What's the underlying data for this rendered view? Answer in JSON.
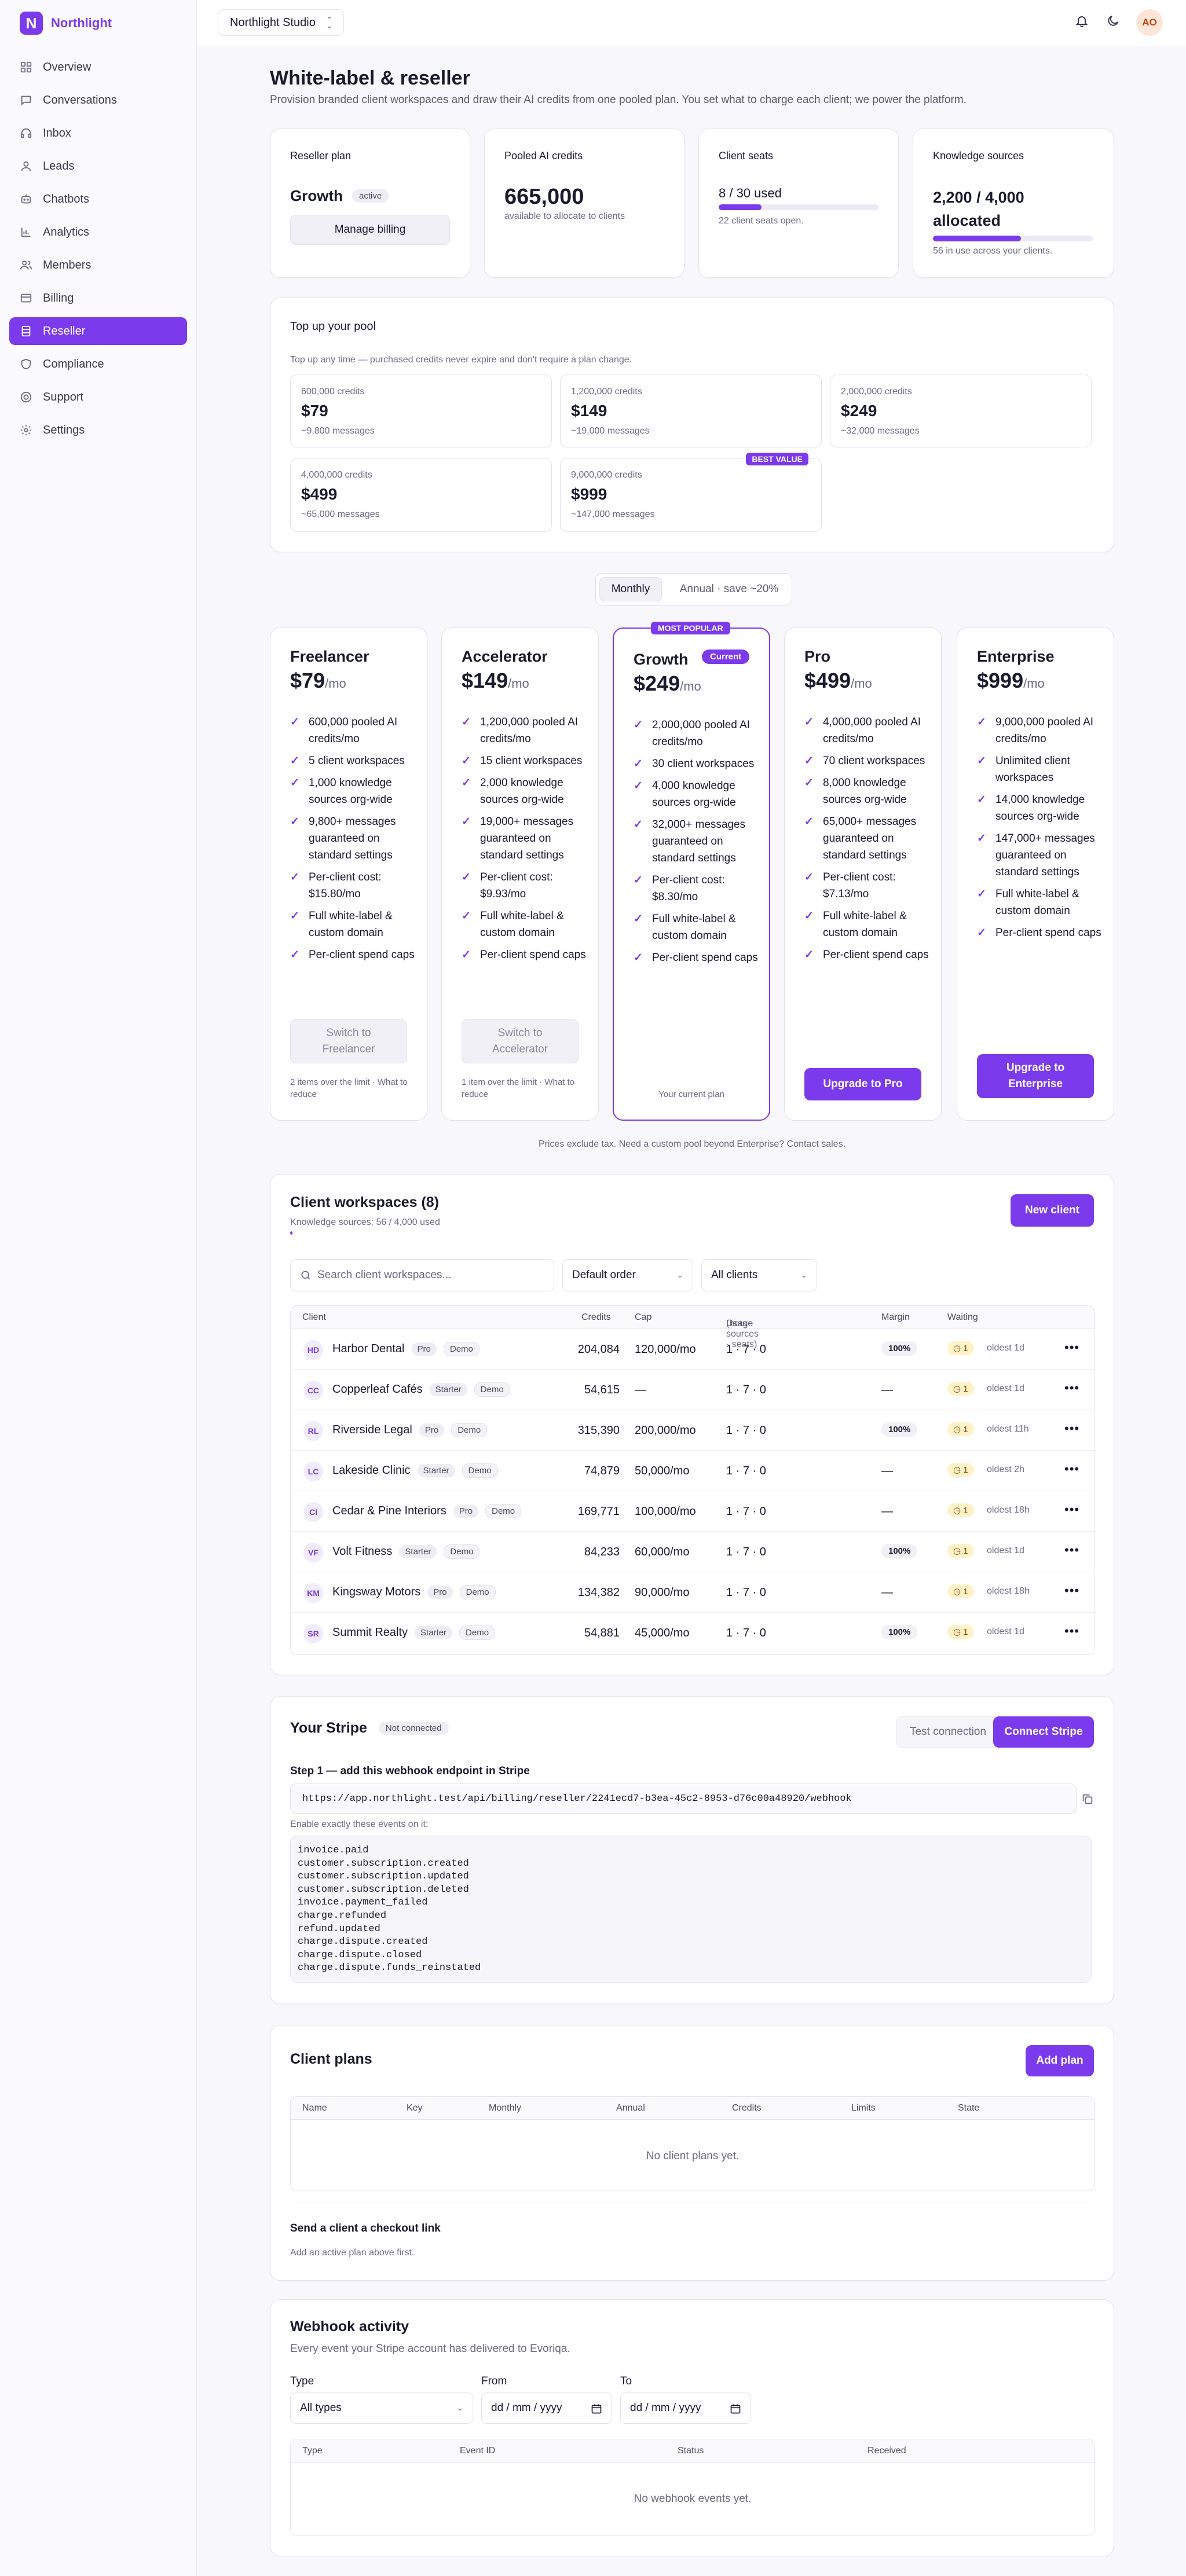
{
  "brand": {
    "name": "Northlight",
    "logo_letter": "N"
  },
  "sidebar": {
    "items": [
      {
        "label": "Overview",
        "icon": "grid-icon"
      },
      {
        "label": "Conversations",
        "icon": "chat-icon"
      },
      {
        "label": "Inbox",
        "icon": "headset-icon"
      },
      {
        "label": "Leads",
        "icon": "user-icon"
      },
      {
        "label": "Chatbots",
        "icon": "bot-icon"
      },
      {
        "label": "Analytics",
        "icon": "chart-icon"
      },
      {
        "label": "Members",
        "icon": "users-icon"
      },
      {
        "label": "Billing",
        "icon": "card-icon"
      },
      {
        "label": "Reseller",
        "icon": "stack-icon"
      },
      {
        "label": "Compliance",
        "icon": "shield-icon"
      },
      {
        "label": "Support",
        "icon": "lifebuoy-icon"
      },
      {
        "label": "Settings",
        "icon": "gear-icon"
      }
    ],
    "active_index": 8
  },
  "topbar": {
    "workspace": "Northlight Studio",
    "avatar": "AO"
  },
  "page": {
    "title": "White-label & reseller",
    "subtitle": "Provision branded client workspaces and draw their AI credits from one pooled plan. You set what to charge each client; we power the platform."
  },
  "stats": {
    "plan": {
      "label": "Reseller plan",
      "value": "Growth",
      "badge": "active",
      "button": "Manage billing"
    },
    "credits": {
      "label": "Pooled AI credits",
      "value": "665,000",
      "note": "available to allocate to clients"
    },
    "seats": {
      "label": "Client seats",
      "value": "8 / 30 used",
      "note": "22 client seats open.",
      "progress": 0.267
    },
    "knowledge": {
      "label": "Knowledge sources",
      "value": "2,200 / 4,000 allocated",
      "note": "56 in use across your clients.",
      "progress": 0.55
    }
  },
  "topup": {
    "title": "Top up your pool",
    "note": "Top up any time — purchased credits never expire and don't require a plan change.",
    "packs": [
      {
        "credits": "600,000 credits",
        "price": "$79",
        "messages": "~9,800 messages"
      },
      {
        "credits": "1,200,000 credits",
        "price": "$149",
        "messages": "~19,000 messages"
      },
      {
        "credits": "2,000,000 credits",
        "price": "$249",
        "messages": "~32,000 messages"
      },
      {
        "credits": "4,000,000 credits",
        "price": "$499",
        "messages": "~65,000 messages"
      },
      {
        "credits": "9,000,000 credits",
        "price": "$999",
        "messages": "~147,000 messages",
        "badge": "BEST VALUE"
      }
    ]
  },
  "billing_toggle": {
    "monthly": "Monthly",
    "annual": "Annual · save ~20%"
  },
  "plans": [
    {
      "name": "Freelancer",
      "price": "$79",
      "per": "/mo",
      "features": [
        "600,000 pooled AI credits/mo",
        "5 client workspaces",
        "1,000 knowledge sources org-wide",
        "9,800+ messages guaranteed on standard settings",
        "Per-client cost: $15.80/mo",
        "Full white-label & custom domain",
        "Per-client spend caps"
      ],
      "button": "Switch to Freelancer",
      "note": "2 items over the limit · What to reduce"
    },
    {
      "name": "Accelerator",
      "price": "$149",
      "per": "/mo",
      "features": [
        "1,200,000 pooled AI credits/mo",
        "15 client workspaces",
        "2,000 knowledge sources org-wide",
        "19,000+ messages guaranteed on standard settings",
        "Per-client cost: $9.93/mo",
        "Full white-label & custom domain",
        "Per-client spend caps"
      ],
      "button": "Switch to Accelerator",
      "note": "1 item over the limit · What to reduce"
    },
    {
      "name": "Growth",
      "price": "$249",
      "per": "/mo",
      "badge": "Current",
      "ribbon": "MOST POPULAR",
      "features": [
        "2,000,000 pooled AI credits/mo",
        "30 client workspaces",
        "4,000 knowledge sources org-wide",
        "32,000+ messages guaranteed on standard settings",
        "Per-client cost: $8.30/mo",
        "Full white-label & custom domain",
        "Per-client spend caps"
      ],
      "note": "Your current plan"
    },
    {
      "name": "Pro",
      "price": "$499",
      "per": "/mo",
      "features": [
        "4,000,000 pooled AI credits/mo",
        "70 client workspaces",
        "8,000 knowledge sources org-wide",
        "65,000+ messages guaranteed on standard settings",
        "Per-client cost: $7.13/mo",
        "Full white-label & custom domain",
        "Per-client spend caps"
      ],
      "button": "Upgrade to Pro"
    },
    {
      "name": "Enterprise",
      "price": "$999",
      "per": "/mo",
      "features": [
        "9,000,000 pooled AI credits/mo",
        "Unlimited client workspaces",
        "14,000 knowledge sources org-wide",
        "147,000+ messages guaranteed on standard settings",
        "Full white-label & custom domain",
        "Per-client spend caps"
      ],
      "button": "Upgrade to Enterprise"
    }
  ],
  "plans_footnote": "Prices exclude tax. Need a custom pool beyond Enterprise? Contact sales.",
  "clients": {
    "title": "Client workspaces (8)",
    "knowledge": "Knowledge sources: 56 / 4,000 used",
    "knowledge_progress": 0.014,
    "new_button": "New client",
    "search_placeholder": "Search client workspaces...",
    "order": "Default order",
    "filter": "All clients",
    "columns": {
      "client": "Client",
      "credits": "Credits",
      "cap": "Cap",
      "usage": "Usage",
      "usage_sub": "(bots · sources · seats)",
      "margin": "Margin",
      "waiting": "Waiting"
    },
    "rows": [
      {
        "initials": "HD",
        "name": "Harbor Dental",
        "tier": "Pro",
        "demo": "Demo",
        "credits": "204,084",
        "cap": "120,000/mo",
        "usage": "1 · 7 · 0",
        "margin": "100%",
        "waiting": "1",
        "oldest": "oldest 1d"
      },
      {
        "initials": "CC",
        "name": "Copperleaf Cafés",
        "tier": "Starter",
        "demo": "Demo",
        "credits": "54,615",
        "cap": "—",
        "usage": "1 · 7 · 0",
        "margin": "—",
        "waiting": "1",
        "oldest": "oldest 1d"
      },
      {
        "initials": "RL",
        "name": "Riverside Legal",
        "tier": "Pro",
        "demo": "Demo",
        "credits": "315,390",
        "cap": "200,000/mo",
        "usage": "1 · 7 · 0",
        "margin": "100%",
        "waiting": "1",
        "oldest": "oldest 11h"
      },
      {
        "initials": "LC",
        "name": "Lakeside Clinic",
        "tier": "Starter",
        "demo": "Demo",
        "credits": "74,879",
        "cap": "50,000/mo",
        "usage": "1 · 7 · 0",
        "margin": "—",
        "waiting": "1",
        "oldest": "oldest 2h"
      },
      {
        "initials": "CI",
        "name": "Cedar & Pine Interiors",
        "tier": "Pro",
        "demo": "Demo",
        "credits": "169,771",
        "cap": "100,000/mo",
        "usage": "1 · 7 · 0",
        "margin": "—",
        "waiting": "1",
        "oldest": "oldest 18h"
      },
      {
        "initials": "VF",
        "name": "Volt Fitness",
        "tier": "Starter",
        "demo": "Demo",
        "credits": "84,233",
        "cap": "60,000/mo",
        "usage": "1 · 7 · 0",
        "margin": "100%",
        "waiting": "1",
        "oldest": "oldest 1d"
      },
      {
        "initials": "KM",
        "name": "Kingsway Motors",
        "tier": "Pro",
        "demo": "Demo",
        "credits": "134,382",
        "cap": "90,000/mo",
        "usage": "1 · 7 · 0",
        "margin": "—",
        "waiting": "1",
        "oldest": "oldest 18h"
      },
      {
        "initials": "SR",
        "name": "Summit Realty",
        "tier": "Starter",
        "demo": "Demo",
        "credits": "54,881",
        "cap": "45,000/mo",
        "usage": "1 · 7 · 0",
        "margin": "100%",
        "waiting": "1",
        "oldest": "oldest 1d"
      }
    ]
  },
  "stripe": {
    "title": "Your Stripe",
    "status": "Not connected",
    "test_button": "Test connection",
    "connect_button": "Connect Stripe",
    "step": "Step 1 — add this webhook endpoint in Stripe",
    "url": "https://app.northlight.test/api/billing/reseller/2241ecd7-b3ea-45c2-8953-d76c00a48920/webhook",
    "events_label": "Enable exactly these events on it:",
    "events": "invoice.paid\ncustomer.subscription.created\ncustomer.subscription.updated\ncustomer.subscription.deleted\ninvoice.payment_failed\ncharge.refunded\nrefund.updated\ncharge.dispute.created\ncharge.dispute.closed\ncharge.dispute.funds_reinstated"
  },
  "client_plans": {
    "title": "Client plans",
    "add_button": "Add plan",
    "columns": {
      "name": "Name",
      "key": "Key",
      "monthly": "Monthly",
      "annual": "Annual",
      "credits": "Credits",
      "limits": "Limits",
      "state": "State"
    },
    "empty": "No client plans yet.",
    "checkout_title": "Send a client a checkout link",
    "checkout_note": "Add an active plan above first."
  },
  "webhooks": {
    "title": "Webhook activity",
    "subtitle": "Every event your Stripe account has delivered to Evoriqa.",
    "type_label": "Type",
    "type_value": "All types",
    "from_label": "From",
    "to_label": "To",
    "date_placeholder": "dd / mm / yyyy",
    "columns": {
      "type": "Type",
      "event_id": "Event ID",
      "status": "Status",
      "received": "Received"
    },
    "empty": "No webhook events yet."
  }
}
